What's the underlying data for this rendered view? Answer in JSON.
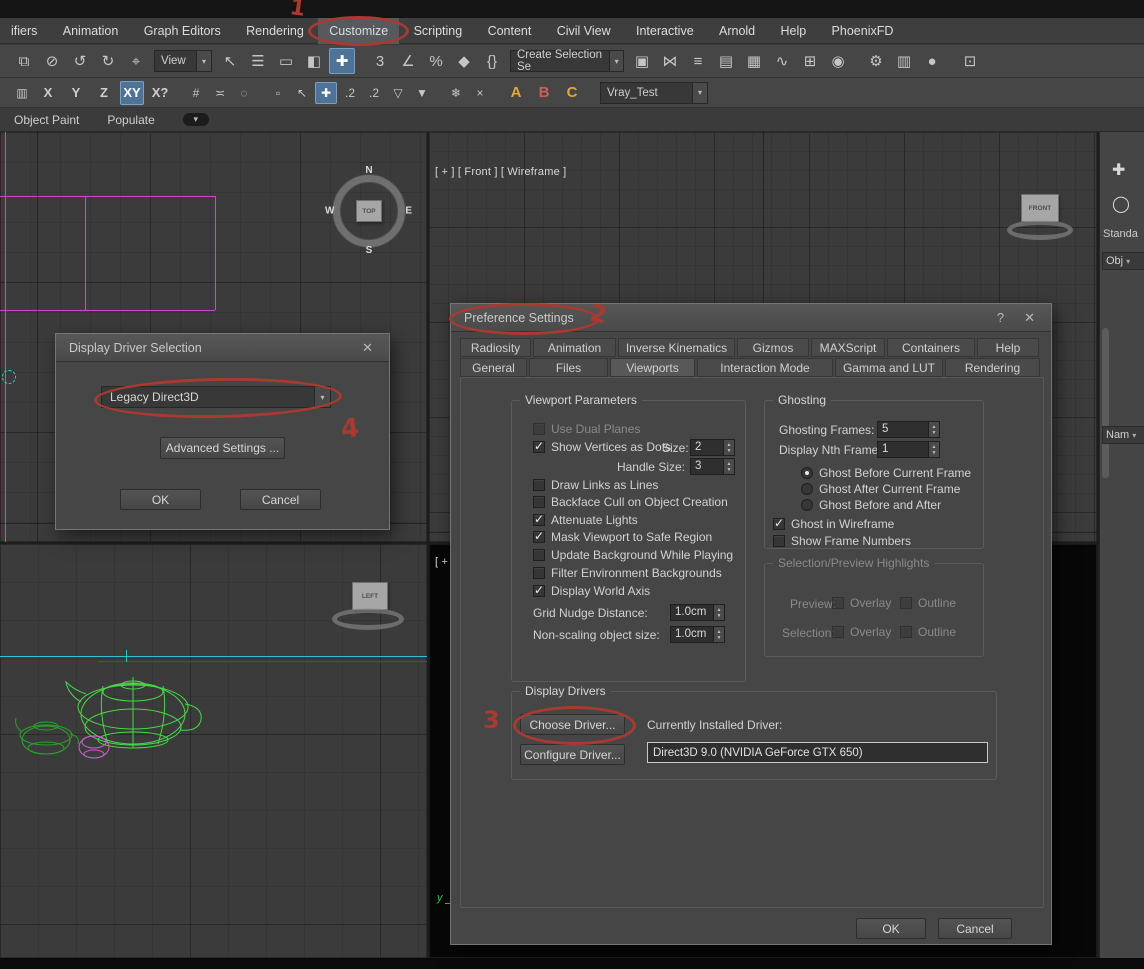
{
  "colors": {
    "annotation_red": "#a83a30",
    "accent_blue": "#4f7396"
  },
  "annotations": {
    "step1": "1",
    "step2": "2",
    "step3": "3",
    "step4": "4"
  },
  "app": {
    "menubar": [
      "ifiers",
      "Animation",
      "Graph Editors",
      "Rendering",
      "Customize",
      "Scripting",
      "Content",
      "Civil View",
      "Interactive",
      "Arnold",
      "Help",
      "PhoenixFD"
    ],
    "ribbon_tabs": [
      "Object Paint",
      "Populate"
    ],
    "toolbar": {
      "view_dropdown": "View",
      "selection_set_dropdown": "Create Selection Se",
      "named_set_dropdown": "Vray_Test",
      "axis_constraints": [
        "X",
        "Y",
        "Z",
        "XY",
        "X?"
      ]
    }
  },
  "icons": {
    "r1": [
      {
        "n": "select-and-link-icon",
        "g": "⧉"
      },
      {
        "n": "unlink-selection-icon",
        "g": "⊘"
      },
      {
        "n": "undo-icon",
        "g": "↺"
      },
      {
        "n": "redo-icon",
        "g": "↻"
      },
      {
        "n": "selection-filter-icon",
        "g": "⌖"
      },
      {
        "n": "select-object-icon",
        "g": "↖"
      },
      {
        "n": "select-by-name-icon",
        "g": "☰"
      },
      {
        "n": "rectangular-selection-icon",
        "g": "▭"
      },
      {
        "n": "window-crossing-icon",
        "g": "◧"
      },
      {
        "n": "select-and-move-icon",
        "g": "✚"
      },
      {
        "n": "snap-toggle-icon",
        "g": "3"
      },
      {
        "n": "angle-snap-icon",
        "g": "∠"
      },
      {
        "n": "percent-snap-icon",
        "g": "%"
      },
      {
        "n": "spinner-snap-icon",
        "g": "◆"
      },
      {
        "n": "keyboard-override-icon",
        "g": "{}"
      },
      {
        "n": "named-selection-sets-icon",
        "g": "▣"
      },
      {
        "n": "mirror-icon",
        "g": "⋈"
      },
      {
        "n": "align-icon",
        "g": "≡"
      },
      {
        "n": "layer-manager-icon",
        "g": "▤"
      },
      {
        "n": "ribbon-toggle-icon",
        "g": "▦"
      },
      {
        "n": "curve-editor-icon",
        "g": "∿"
      },
      {
        "n": "schematic-view-icon",
        "g": "⊞"
      },
      {
        "n": "material-editor-icon",
        "g": "◉"
      },
      {
        "n": "render-setup-icon",
        "g": "⚙"
      },
      {
        "n": "rendered-frame-icon",
        "g": "▥"
      },
      {
        "n": "render-production-icon",
        "g": "●"
      },
      {
        "n": "workspace-icon",
        "g": "⊡"
      }
    ],
    "r2": [
      {
        "n": "scene-explorer-icon",
        "g": "▥"
      },
      {
        "n": "grid-snap-icon",
        "g": "#"
      },
      {
        "n": "measure-icon",
        "g": "≍"
      },
      {
        "n": "soft-selection-icon",
        "g": "◌"
      },
      {
        "n": "marker-snap-icon",
        "g": "▫"
      },
      {
        "n": "cursor-snap-icon",
        "g": "↖"
      },
      {
        "n": "placement-tool-icon",
        "g": "✚"
      },
      {
        "n": "snap-2d-icon",
        "g": ".2"
      },
      {
        "n": "snap-25d-icon",
        "g": ".2"
      },
      {
        "n": "v-constraint-icon",
        "g": "▽"
      },
      {
        "n": "v-add-constraint-icon",
        "g": "▼"
      },
      {
        "n": "snowflake-icon",
        "g": "❄"
      },
      {
        "n": "x-toggle-icon",
        "g": "×"
      },
      {
        "n": "letter-a-icon",
        "g": "A"
      },
      {
        "n": "letter-b-icon",
        "g": "B"
      },
      {
        "n": "letter-c-icon",
        "g": "C"
      }
    ],
    "panel": [
      {
        "n": "create-plus-icon",
        "g": "✚"
      },
      {
        "n": "geometry-circle-icon",
        "g": "◯"
      }
    ],
    "ribbon_more": "▾",
    "dropdown_arrow": "▾"
  },
  "viewports": {
    "front_label": "[ + ] [ Front ] [ Wireframe ]",
    "camera_label": "[ + ]",
    "top_gizmo": "TOP",
    "left_gizmo": "LEFT",
    "front_gizmo": "FRONT",
    "compass_n": "N",
    "compass_w": "W",
    "compass_e": "E",
    "compass_s": "S",
    "camera_axis": "y"
  },
  "command_panel": {
    "standard_label": "Standa",
    "object_rollout": "Obj",
    "name_rollout": "Nam"
  },
  "driver_dialog": {
    "title": "Display Driver Selection",
    "close": "✕",
    "driver_value": "Legacy Direct3D",
    "advanced_button": "Advanced Settings ...",
    "ok": "OK",
    "cancel": "Cancel"
  },
  "preferences": {
    "title": "Preference Settings",
    "help": "?",
    "close": "✕",
    "tabs_row1": [
      "Radiosity",
      "Animation",
      "Inverse Kinematics",
      "Gizmos",
      "MAXScript",
      "Containers",
      "Help"
    ],
    "tabs_row2": [
      "General",
      "Files",
      "Viewports",
      "Interaction Mode",
      "Gamma and LUT",
      "Rendering"
    ],
    "active_tab": "Viewports",
    "viewport_parameters": {
      "title": "Viewport Parameters",
      "items": [
        {
          "label": "Use Dual Planes",
          "checked": false
        },
        {
          "label": "Show Vertices as Dots",
          "checked": true
        },
        {
          "label": "Draw Links as Lines",
          "checked": false
        },
        {
          "label": "Backface Cull on Object Creation",
          "checked": false
        },
        {
          "label": "Attenuate Lights",
          "checked": true
        },
        {
          "label": "Mask Viewport to Safe Region",
          "checked": true
        },
        {
          "label": "Update Background While Playing",
          "checked": false
        },
        {
          "label": "Filter Environment Backgrounds",
          "checked": false
        },
        {
          "label": "Display World Axis",
          "checked": true
        }
      ],
      "size_label": "Size:",
      "size_value": "2",
      "handle_label": "Handle Size:",
      "handle_value": "3",
      "grid_nudge_label": "Grid Nudge Distance:",
      "grid_nudge_value": "1.0cm",
      "non_scaling_label": "Non-scaling object size:",
      "non_scaling_value": "1.0cm"
    },
    "ghosting": {
      "title": "Ghosting",
      "frames_label": "Ghosting Frames:",
      "frames_value": "5",
      "nth_label": "Display Nth Frame:",
      "nth_value": "1",
      "radios": [
        {
          "label": "Ghost Before Current Frame",
          "selected": true
        },
        {
          "label": "Ghost After Current Frame",
          "selected": false
        },
        {
          "label": "Ghost Before and After",
          "selected": false
        }
      ],
      "checks": [
        {
          "label": "Ghost in Wireframe",
          "checked": true
        },
        {
          "label": "Show Frame Numbers",
          "checked": false
        }
      ]
    },
    "selection_preview": {
      "title": "Selection/Preview Highlights",
      "preview_label": "Preview:",
      "selection_label": "Selection:",
      "overlay": "Overlay",
      "outline": "Outline"
    },
    "display_drivers": {
      "title": "Display Drivers",
      "choose_button": "Choose Driver...",
      "configure_button": "Configure Driver...",
      "installed_label": "Currently Installed Driver:",
      "installed_value": "Direct3D 9.0 (NVIDIA GeForce GTX 650)"
    },
    "ok": "OK",
    "cancel": "Cancel"
  }
}
